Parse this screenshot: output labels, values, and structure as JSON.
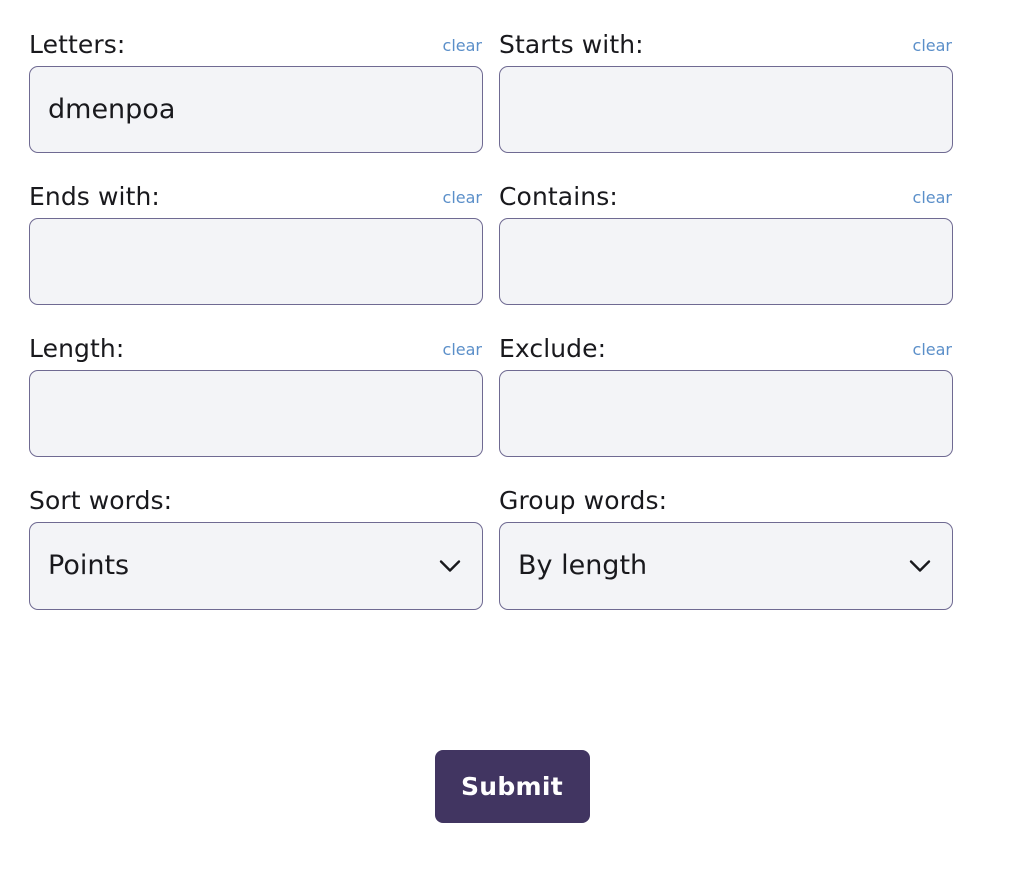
{
  "theme": {
    "page_background": "#ffffff",
    "input_background": "#f3f4f7",
    "input_border": "#6f6a92",
    "label_color": "#19191d",
    "clear_link_color": "#5b8fc9",
    "submit_background": "#413561",
    "submit_text_color": "#ffffff"
  },
  "form": {
    "fields": [
      {
        "label": "Letters:",
        "clear_label": "clear",
        "value": "dmenpoa",
        "placeholder": "",
        "name": "letters"
      },
      {
        "label": "Starts with:",
        "clear_label": "clear",
        "value": "",
        "placeholder": "",
        "name": "starts-with"
      },
      {
        "label": "Ends with:",
        "clear_label": "clear",
        "value": "",
        "placeholder": "",
        "name": "ends-with"
      },
      {
        "label": "Contains:",
        "clear_label": "clear",
        "value": "",
        "placeholder": "",
        "name": "contains"
      },
      {
        "label": "Length:",
        "clear_label": "clear",
        "value": "",
        "placeholder": "",
        "name": "length"
      },
      {
        "label": "Exclude:",
        "clear_label": "clear",
        "value": "",
        "placeholder": "",
        "name": "exclude"
      }
    ],
    "selects": [
      {
        "label": "Sort words:",
        "selected": "Points",
        "name": "sort-words",
        "icon": "chevron-down-icon"
      },
      {
        "label": "Group words:",
        "selected": "By length",
        "name": "group-words",
        "icon": "chevron-down-icon"
      }
    ],
    "submit": {
      "label": "Submit"
    }
  }
}
